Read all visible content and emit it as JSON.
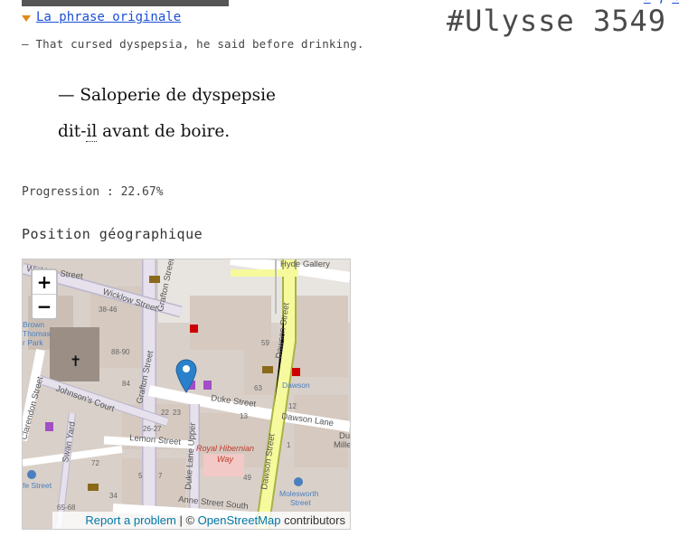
{
  "header": {
    "top_links": [
      "←",
      "→"
    ],
    "title": "#Ulysse 3549"
  },
  "original": {
    "toggle_label": "La phrase originale",
    "text": "— That cursed dyspepsia, he said before drinking."
  },
  "translation": {
    "line1": "— Saloperie de dyspepsie",
    "line2_before": "dit-",
    "line2_dotted": "il",
    "line2_after": " avant de boire."
  },
  "progress": {
    "label": "Progression : 22.67%",
    "percent": 22.67
  },
  "geo": {
    "heading": "Position géographique",
    "zoom_in": "+",
    "zoom_out": "−",
    "attribution": {
      "report": "Report a problem",
      "sep": " | © ",
      "osm": "OpenStreetMap",
      "contributors": " contributors"
    },
    "streets": {
      "wicklow1": "Wicklow Street",
      "wicklow2": "Wicklow Street",
      "grafton1": "Grafton Street",
      "grafton2": "Grafton Street",
      "johnsons": "Johnson's Court",
      "duke": "Duke Street",
      "dawson_lane": "Dawson Lane",
      "dawson": "Dawson Street",
      "dawson2": "Dawson Street",
      "lemon": "Lemon Street",
      "duke_upper": "Duke Lane Upper",
      "anne": "Anne Street South",
      "clarendon": "Clarendon Street",
      "swan": "Swan Yard",
      "royal": "Royal Hibernian",
      "way": "Way",
      "hyde": "Hyde Gallery",
      "brown": "Brown",
      "thomas": "Thomas",
      "park": "r Park",
      "dawson_poi": "Dawson",
      "molesworth": "Molesworth",
      "molesworth2": "Street",
      "dub": "Dubl",
      "millen": "Millenn",
      "fe_street": "fe Street"
    },
    "numbers": [
      "38-46",
      "88-90",
      "84",
      "22",
      "23",
      "26-27",
      "72",
      "65-68",
      "34",
      "59",
      "63",
      "12",
      "13",
      "49",
      "1",
      "5",
      "7"
    ]
  },
  "colors": {
    "link": "#1a4fd6",
    "accent_triangle": "#e08a1e",
    "marker": "#2a81cb"
  }
}
